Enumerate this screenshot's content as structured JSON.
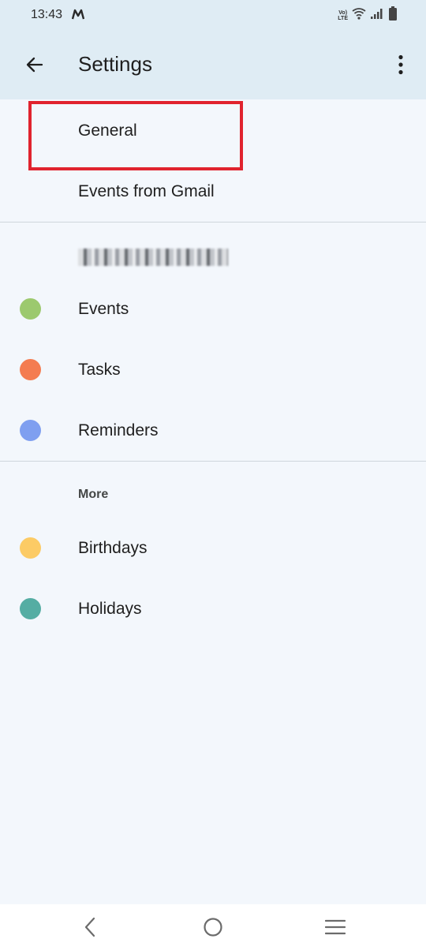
{
  "status_bar": {
    "time": "13:43",
    "volte_line1": "Vo)",
    "volte_line2": "LTE"
  },
  "app_bar": {
    "title": "Settings"
  },
  "top_items": [
    {
      "label": "General"
    },
    {
      "label": "Events from Gmail"
    }
  ],
  "account": {
    "items": [
      {
        "label": "Events",
        "color": "#9cc96e"
      },
      {
        "label": "Tasks",
        "color": "#f47c51"
      },
      {
        "label": "Reminders",
        "color": "#7f9ff0"
      }
    ]
  },
  "more_section": {
    "header": "More",
    "items": [
      {
        "label": "Birthdays",
        "color": "#fccb65"
      },
      {
        "label": "Holidays",
        "color": "#55ada3"
      }
    ]
  },
  "colors": {
    "header_bg": "#dfecf4",
    "page_bg": "#f3f7fc",
    "highlight": "#e0232e"
  }
}
